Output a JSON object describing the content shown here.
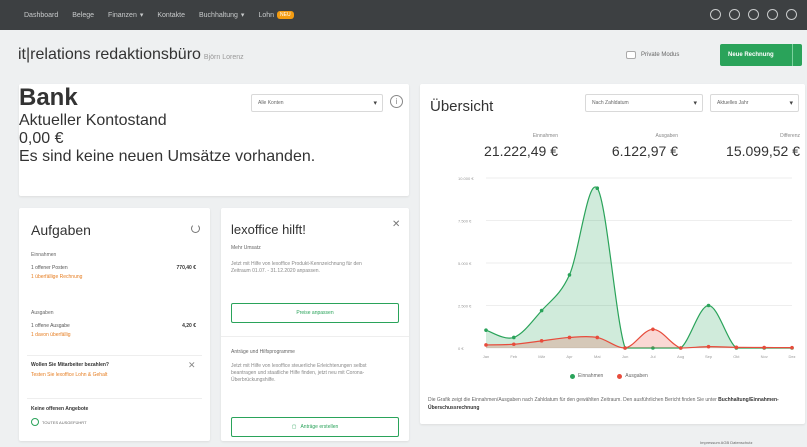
{
  "nav": {
    "items": [
      {
        "label": "Dashboard",
        "caret": false
      },
      {
        "label": "Belege",
        "caret": false
      },
      {
        "label": "Finanzen",
        "caret": true
      },
      {
        "label": "Kontakte",
        "caret": false
      },
      {
        "label": "Buchhaltung",
        "caret": true
      },
      {
        "label": "Lohn",
        "caret": false
      }
    ],
    "lohn_badge": "NEU",
    "icons": [
      "heart-icon",
      "dashboard-icon",
      "help-icon",
      "search-icon",
      "gear-icon"
    ]
  },
  "header": {
    "company": "it|relations redaktionsbüro",
    "user": "Björn Lorenz",
    "private_label": "Private Modus",
    "new_invoice_label": "Neue Rechnung"
  },
  "bank": {
    "title": "Bank",
    "account_select": "Alle Konten",
    "balance_label": "Aktueller Kontostand",
    "balance": "0,00 €",
    "notice": "Es sind keine neuen Umsätze vorhanden."
  },
  "tasks": {
    "title": "Aufgaben",
    "income_label": "Einnahmen",
    "open_items": "1 offener Posten",
    "open_items_value": "770,40 €",
    "overdue_invoice": "1 überfällige Rechnung",
    "expenses_label": "Ausgaben",
    "open_expense": "1 offene Ausgabe",
    "open_expense_value": "4,20 €",
    "overdue_expense": "1 davon überfällig",
    "employees_q": "Wollen Sie Mitarbeiter bezahlen?",
    "employees_link": "Testen Sie lexoffice Lohn & Gehalt",
    "no_offers": "Keine offenen Angebote",
    "paid_label": "TOUTES AUSGEFÜHRT"
  },
  "help": {
    "title": "lexoffice hilft!",
    "subtitle": "Mehr Umsatz",
    "body1": "Jetzt mit Hilfe von lexoffice Produkt-Kennzeichnung für den Zeitraum 01.07. - 31.12.2020 anpassen.",
    "btn1": "Preise anpassen",
    "section2": "Anträge und Hilfsprogramme",
    "body2": "Jetzt mit Hilfe von lexoffice steuerliche Erleichterungen selbst beantragen und staatliche Hilfe finden, jetzt neu mit Corona-Überbrückungshilfe.",
    "btn2": "Anträge erstellen"
  },
  "overview": {
    "title": "Übersicht",
    "period_select": "Nach Zahldatum",
    "year_select": "Aktuelles Jahr",
    "income_label": "Einnahmen",
    "income": "21.222,49 €",
    "expense_label": "Ausgaben",
    "expense": "6.122,97 €",
    "diff_label": "Differenz",
    "diff": "15.099,52 €",
    "note_pre": "Die Grafik zeigt die Einnahmen/Ausgaben nach Zahldatum für den gewählten Zeitraum. Den ausführlichen Bericht finden Sie unter",
    "note_link": "Buchhaltung/Einnahmen-Überschussrechnung"
  },
  "chart_data": {
    "type": "area",
    "categories": [
      "Jan",
      "Feb",
      "Mär",
      "Apr",
      "Mai",
      "Jun",
      "Jul",
      "Aug",
      "Sep",
      "Okt",
      "Nov",
      "Dez"
    ],
    "yticks": [
      "10.000 €",
      "7.500 €",
      "5.000 €",
      "2.500 €",
      "0 €"
    ],
    "ylim": [
      0,
      10000
    ],
    "series": [
      {
        "name": "Einnahmen",
        "color": "#2aa35a",
        "values": [
          1050,
          620,
          2200,
          4300,
          9400,
          0,
          0,
          0,
          2500,
          0,
          0,
          0
        ]
      },
      {
        "name": "Ausgaben",
        "color": "#e74c3c",
        "values": [
          180,
          220,
          420,
          620,
          620,
          0,
          1100,
          0,
          80,
          40,
          30,
          20
        ]
      }
    ],
    "legend_position": "bottom"
  },
  "footer": "Impressum AGB Datenschutz"
}
